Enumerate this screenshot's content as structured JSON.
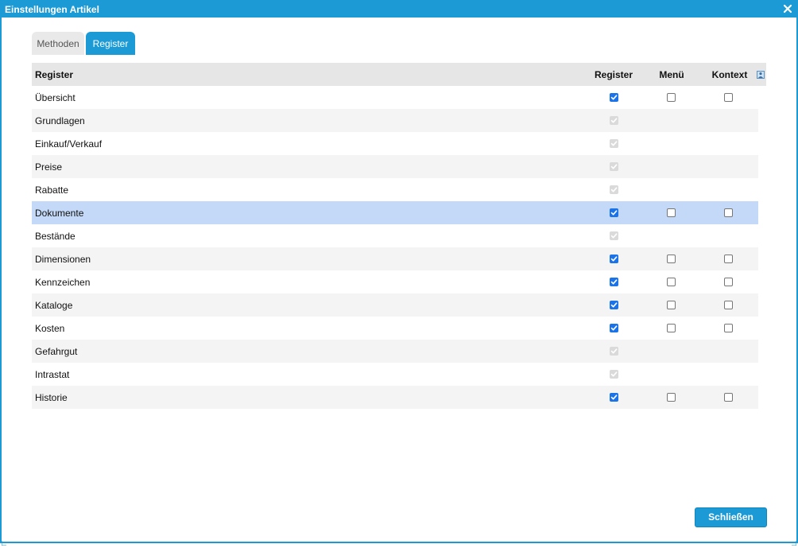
{
  "window": {
    "title": "Einstellungen Artikel"
  },
  "tabs": [
    {
      "label": "Methoden",
      "active": false
    },
    {
      "label": "Register",
      "active": true
    }
  ],
  "grid": {
    "headers": {
      "name": "Register",
      "register": "Register",
      "menu": "Menü",
      "kontext": "Kontext"
    },
    "rows": [
      {
        "label": "Übersicht",
        "register": "checked",
        "menu": "unchecked",
        "kontext": "unchecked"
      },
      {
        "label": "Grundlagen",
        "register": "disabled",
        "menu": null,
        "kontext": null
      },
      {
        "label": "Einkauf/Verkauf",
        "register": "disabled",
        "menu": null,
        "kontext": null
      },
      {
        "label": "Preise",
        "register": "disabled",
        "menu": null,
        "kontext": null
      },
      {
        "label": "Rabatte",
        "register": "disabled",
        "menu": null,
        "kontext": null
      },
      {
        "label": "Dokumente",
        "register": "checked",
        "menu": "unchecked",
        "kontext": "unchecked",
        "selected": true
      },
      {
        "label": "Bestände",
        "register": "disabled",
        "menu": null,
        "kontext": null
      },
      {
        "label": "Dimensionen",
        "register": "checked",
        "menu": "unchecked",
        "kontext": "unchecked"
      },
      {
        "label": "Kennzeichen",
        "register": "checked",
        "menu": "unchecked",
        "kontext": "unchecked"
      },
      {
        "label": "Kataloge",
        "register": "checked",
        "menu": "unchecked",
        "kontext": "unchecked"
      },
      {
        "label": "Kosten",
        "register": "checked",
        "menu": "unchecked",
        "kontext": "unchecked"
      },
      {
        "label": "Gefahrgut",
        "register": "disabled",
        "menu": null,
        "kontext": null
      },
      {
        "label": "Intrastat",
        "register": "disabled",
        "menu": null,
        "kontext": null
      },
      {
        "label": "Historie",
        "register": "checked",
        "menu": "unchecked",
        "kontext": "unchecked"
      }
    ]
  },
  "footer": {
    "close_label": "Schließen"
  },
  "colors": {
    "accent": "#1b9ad6",
    "selected_row": "#c3d9f7",
    "checkbox_checked": "#1a73e8"
  },
  "icons": {
    "close": "close-icon",
    "column_chooser": "column-chooser-icon"
  }
}
